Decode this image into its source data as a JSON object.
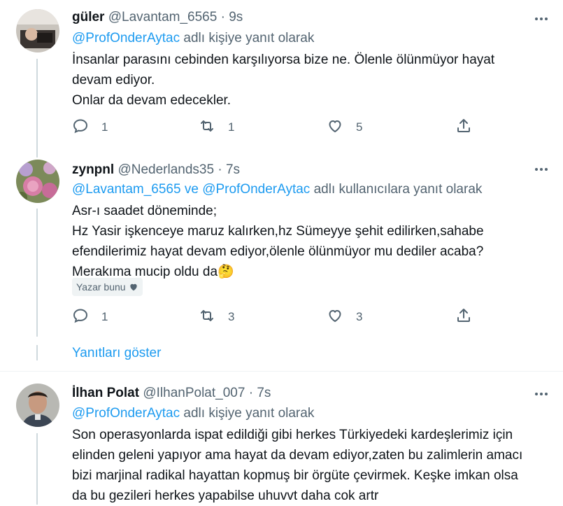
{
  "tweets": [
    {
      "name": "güler",
      "handle": "@Lavantam_6565",
      "dot": "·",
      "time": "9s",
      "reply_prefix": "",
      "reply_mentions": [
        "@ProfOnderAytac"
      ],
      "reply_joiner": "",
      "reply_suffix": " adlı kişiye yanıt olarak",
      "lines": [
        "İnsanlar parasını cebinden karşılıyorsa bize ne. Ölenle ölünmüyor hayat",
        "devam ediyor.",
        "Onlar da devam edecekler."
      ],
      "counts": {
        "reply": "1",
        "retweet": "1",
        "like": "5"
      }
    },
    {
      "name": "zynpnl",
      "handle": "@Nederlands35",
      "dot": "·",
      "time": "7s",
      "reply_mentions": [
        "@Lavantam_6565",
        "@ProfOnderAytac"
      ],
      "reply_joiner": " ve ",
      "reply_suffix": " adlı kullanıcılara yanıt olarak",
      "lines": [
        "Asr-ı saadet döneminde;",
        "Hz Yasir işkenceye maruz kalırken,hz Sümeyye şehit edilirken,sahabe",
        "efendilerimiz hayat devam ediyor,ölenle ölünmüyor mu dediler acaba?",
        "Merakıma mucip oldu da"
      ],
      "emoji": "🤔",
      "badge": "Yazar bunu",
      "counts": {
        "reply": "1",
        "retweet": "3",
        "like": "3"
      }
    },
    {
      "name": "İlhan Polat",
      "handle": "@IlhanPolat_007",
      "dot": "·",
      "time": "7s",
      "reply_mentions": [
        "@ProfOnderAytac"
      ],
      "reply_joiner": "",
      "reply_suffix": " adlı kişiye yanıt olarak",
      "lines": [
        "Son operasyonlarda ispat edildiği gibi herkes Türkiyedeki kardeşlerimiz için",
        "elinden geleni yapıyor ama hayat da devam ediyor,zaten bu zalimlerin amacı",
        "bizi marjinal radikal hayattan kopmuş bir örgüte çevirmek. Keşke imkan olsa",
        "da bu gezileri herkes yapabilse uhuvvt daha cok artr"
      ]
    }
  ],
  "show_replies": "Yanıtları göster",
  "colors": {
    "accent": "#1d9bf0",
    "muted": "#536471",
    "text": "#0f1419",
    "line": "#cfd9de"
  },
  "icons": [
    "more-icon",
    "reply-icon",
    "retweet-icon",
    "like-icon",
    "share-icon",
    "heart-icon"
  ]
}
